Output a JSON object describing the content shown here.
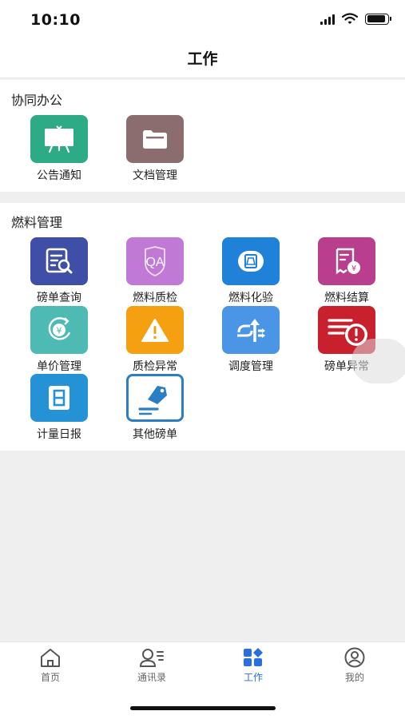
{
  "status_bar": {
    "time": "10:10",
    "battery_level": 0.9
  },
  "header": {
    "title": "工作"
  },
  "sections": [
    {
      "title": "协同办公",
      "items": [
        {
          "label": "公告通知",
          "icon": "announcement-board-icon",
          "color": "#2daa86"
        },
        {
          "label": "文档管理",
          "icon": "folder-icon",
          "color": "#8b6d6f"
        }
      ]
    },
    {
      "title": "燃料管理",
      "items": [
        {
          "label": "磅单查询",
          "icon": "document-search-icon",
          "color": "#3f4fa8"
        },
        {
          "label": "燃料质检",
          "icon": "qa-shield-icon",
          "color": "#c07ad6"
        },
        {
          "label": "燃料化验",
          "icon": "lab-flask-icon",
          "color": "#1f82d8"
        },
        {
          "label": "燃料结算",
          "icon": "invoice-yen-icon",
          "color": "#b93f8e"
        },
        {
          "label": "单价管理",
          "icon": "yen-cycle-icon",
          "color": "#4dbab4"
        },
        {
          "label": "质检异常",
          "icon": "warning-triangle-icon",
          "color": "#f4a010"
        },
        {
          "label": "调度管理",
          "icon": "dispatch-arrows-icon",
          "color": "#4a95e6"
        },
        {
          "label": "磅单异常",
          "icon": "document-alert-icon",
          "color": "#c8202c"
        },
        {
          "label": "计量日报",
          "icon": "daily-calendar-icon",
          "color": "#2592d6"
        },
        {
          "label": "其他磅单",
          "icon": "tag-document-icon",
          "color": "#2a7fc4"
        }
      ]
    }
  ],
  "tab_bar": {
    "active_color": "#2a6fe0",
    "inactive_color": "#555555",
    "tabs": [
      {
        "label": "首页",
        "icon": "home-icon",
        "active": false
      },
      {
        "label": "通讯录",
        "icon": "contacts-icon",
        "active": false
      },
      {
        "label": "工作",
        "icon": "apps-grid-icon",
        "active": true
      },
      {
        "label": "我的",
        "icon": "profile-icon",
        "active": false
      }
    ]
  }
}
